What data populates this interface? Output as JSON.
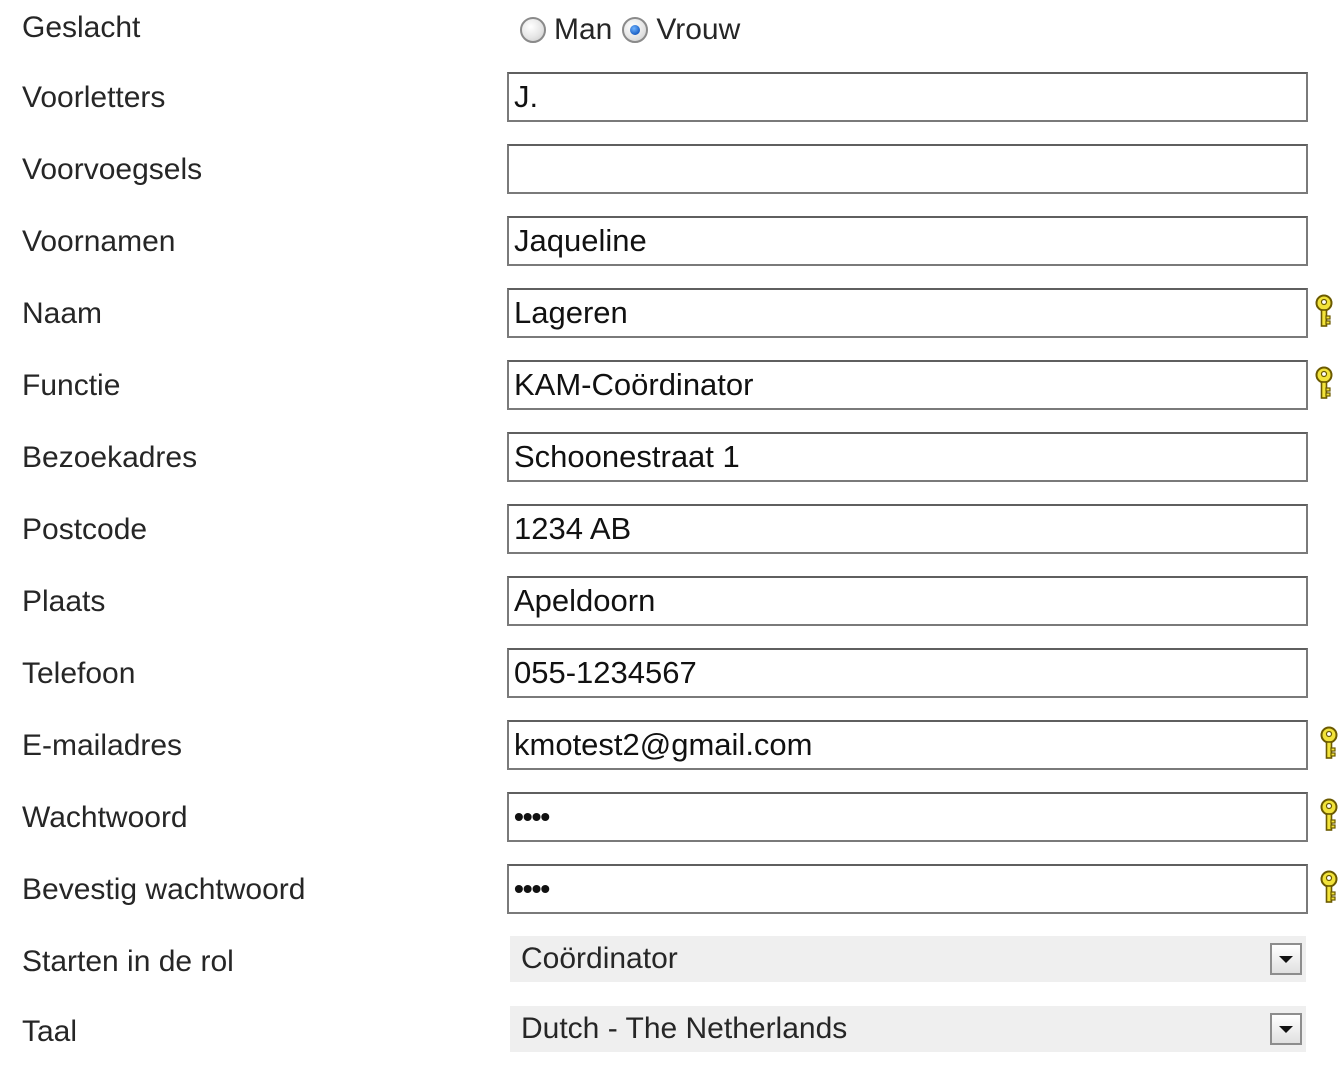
{
  "form": {
    "gender": {
      "label": "Geslacht",
      "options": [
        {
          "label": "Man",
          "checked": false
        },
        {
          "label": "Vrouw",
          "checked": true
        }
      ]
    },
    "initials": {
      "label": "Voorletters",
      "value": "J."
    },
    "prefixes": {
      "label": "Voorvoegsels",
      "value": ""
    },
    "first_names": {
      "label": "Voornamen",
      "value": "Jaqueline"
    },
    "last_name": {
      "label": "Naam",
      "value": "Lageren",
      "required_icon": "key-icon"
    },
    "function": {
      "label": "Functie",
      "value": "KAM-Coördinator",
      "required_icon": "key-icon"
    },
    "visit_address": {
      "label": "Bezoekadres",
      "value": "Schoonestraat 1"
    },
    "postcode": {
      "label": "Postcode",
      "value": "1234 AB"
    },
    "city": {
      "label": "Plaats",
      "value": "Apeldoorn"
    },
    "phone": {
      "label": "Telefoon",
      "value": "055-1234567"
    },
    "email": {
      "label": "E-mailadres",
      "value": "kmotest2@gmail.com",
      "required_icon": "key-icon"
    },
    "password": {
      "label": "Wachtwoord",
      "value": "••••",
      "required_icon": "key-icon"
    },
    "confirm_password": {
      "label": "Bevestig wachtwoord",
      "value": "••••",
      "required_icon": "key-icon"
    },
    "start_role": {
      "label": "Starten in de rol",
      "selected": "Coördinator"
    },
    "language": {
      "label": "Taal",
      "selected": "Dutch - The Netherlands"
    }
  },
  "colors": {
    "key_icon_fill": "#f2e33a",
    "key_icon_stroke": "#6b5a00",
    "field_border": "#7a7a7a",
    "select_bg": "#efefef"
  }
}
